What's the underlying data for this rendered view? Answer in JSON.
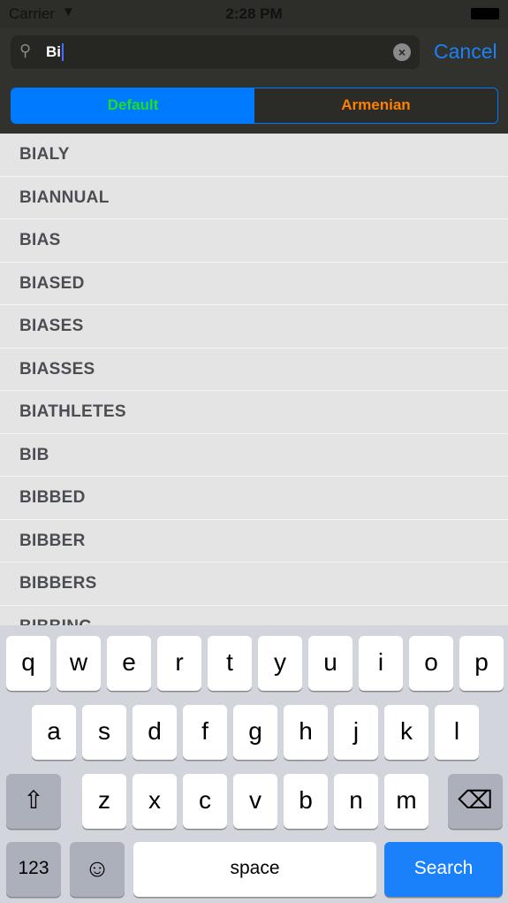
{
  "status": {
    "carrier": "Carrier",
    "time": "2:28 PM"
  },
  "search": {
    "query": "Bi",
    "cancel_label": "Cancel"
  },
  "segments": {
    "default": "Default",
    "armenian": "Armenian",
    "colors": {
      "active_bg": "#007aff",
      "default_text": "#1ee01e",
      "armenian_text": "#ff8000"
    }
  },
  "results": [
    "BIALY",
    "BIANNUAL",
    "BIAS",
    "BIASED",
    "BIASES",
    "BIASSES",
    "BIATHLETES",
    "BIB",
    "BIBBED",
    "BIBBER",
    "BIBBERS",
    "BIBBING"
  ],
  "keyboard": {
    "row1": [
      "q",
      "w",
      "e",
      "r",
      "t",
      "y",
      "u",
      "i",
      "o",
      "p"
    ],
    "row2": [
      "a",
      "s",
      "d",
      "f",
      "g",
      "h",
      "j",
      "k",
      "l"
    ],
    "row3": [
      "z",
      "x",
      "c",
      "v",
      "b",
      "n",
      "m"
    ],
    "numbers": "123",
    "space": "space",
    "search": "Search"
  }
}
